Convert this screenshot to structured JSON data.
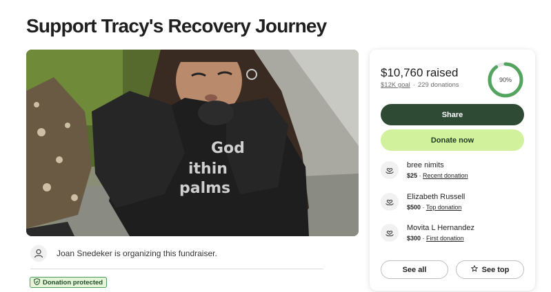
{
  "page": {
    "title": "Support Tracy's Recovery Journey"
  },
  "photo": {
    "alt": "Fundraiser photo",
    "shirt_lines": [
      "God",
      "ithin",
      "palms"
    ]
  },
  "organizer": {
    "text": "Joan Snedeker is organizing this fundraiser.",
    "icon": "person-icon"
  },
  "badge": {
    "label": "Donation protected",
    "icon": "shield-icon"
  },
  "progress": {
    "raised": "$10,760 raised",
    "goal": "$12K goal",
    "donations": "229 donations",
    "percent_label": "90%",
    "percent": 0.9,
    "color": "#52a45e"
  },
  "buttons": {
    "share": "Share",
    "donate": "Donate now",
    "see_all": "See all",
    "see_top": "See top"
  },
  "donors": [
    {
      "name": "bree nimits",
      "amount": "$25",
      "tag": "Recent donation",
      "icon": "heart-hand-icon"
    },
    {
      "name": "Elizabeth Russell",
      "amount": "$500",
      "tag": "Top donation",
      "icon": "heart-hand-icon"
    },
    {
      "name": "Movita L Hernandez",
      "amount": "$300",
      "tag": "First donation",
      "icon": "heart-hand-icon"
    }
  ],
  "colors": {
    "share_bg": "#2e4a34",
    "donate_bg": "#d1f19d",
    "badge_border": "#4a9a5a"
  }
}
